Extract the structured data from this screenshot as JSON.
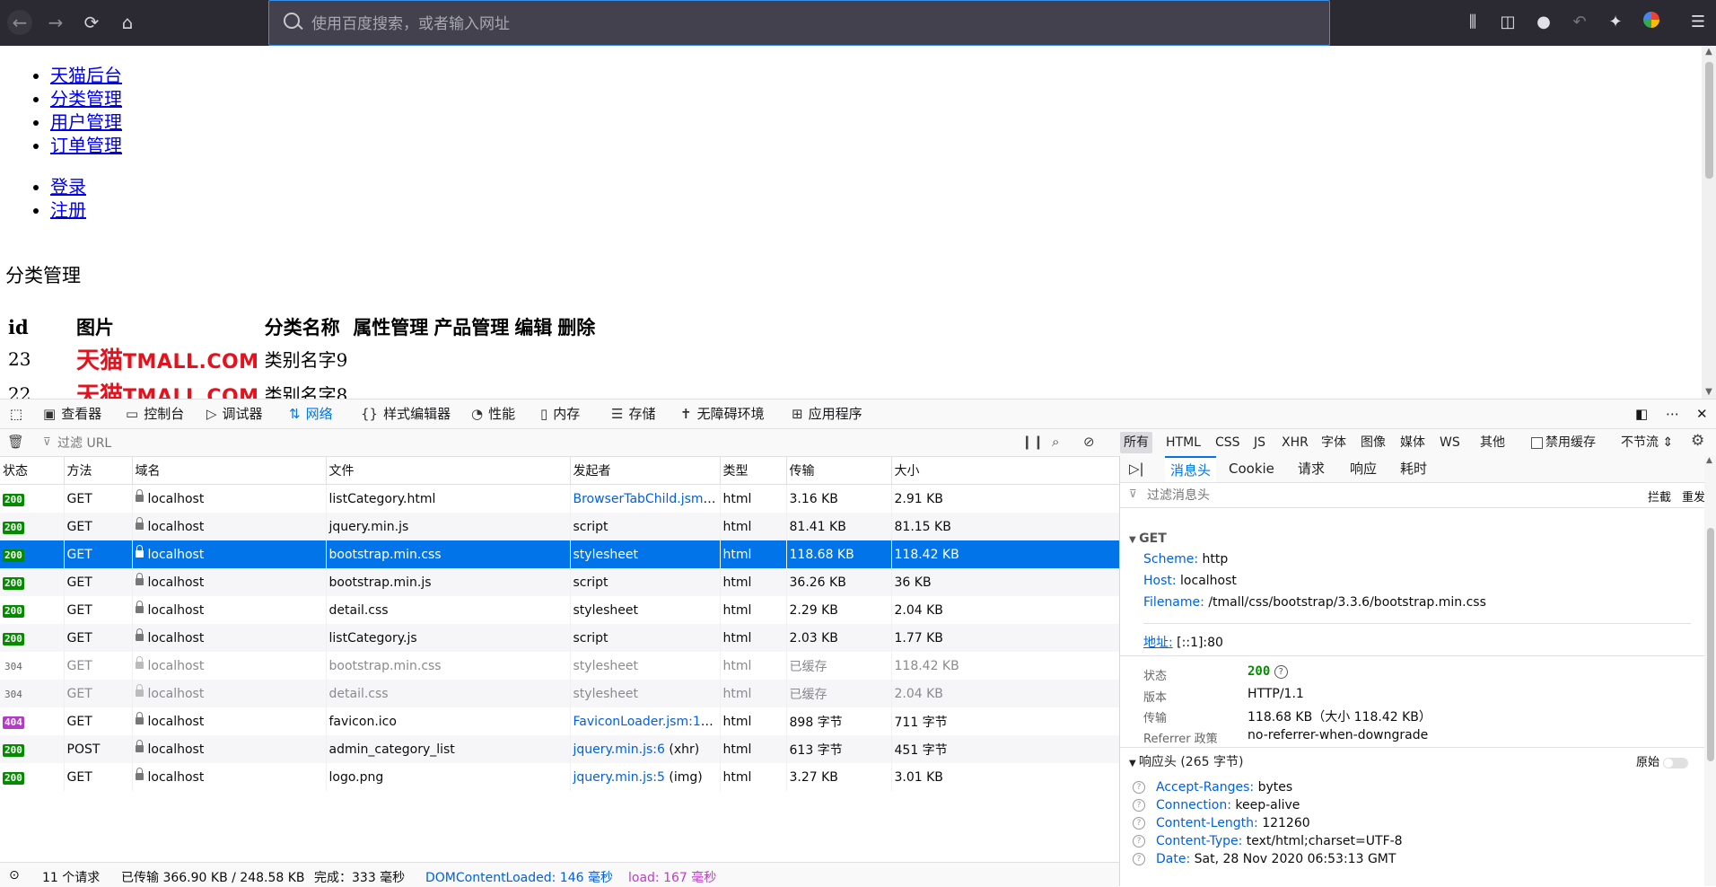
{
  "toolbar": {
    "back_icon": "back-arrow-icon",
    "forward_icon": "forward-arrow-icon",
    "reload_icon": "reload-icon",
    "home_icon": "home-icon",
    "url_placeholder": "使用百度搜索，或者输入网址",
    "right_icons": [
      "library-icon",
      "sidebar-icon",
      "account-icon",
      "undo-icon",
      "extension-icon",
      "browser-logo-icon",
      "menu-icon"
    ]
  },
  "page": {
    "nav_main": [
      "天猫后台",
      "分类管理",
      "用户管理",
      "订单管理"
    ],
    "nav_account": [
      "登录",
      "注册"
    ],
    "section_title": "分类管理",
    "table": {
      "headers": [
        "id",
        "图片",
        "分类名称",
        "属性管理",
        "产品管理",
        "编辑",
        "删除"
      ],
      "rows": [
        {
          "id": "23",
          "logo_cn": "天猫",
          "logo_en": "TMALL.COM",
          "name": "类别名字9"
        },
        {
          "id": "22",
          "logo_cn": "天猫",
          "logo_en": "TMALL.COM",
          "name": "类别名字8"
        }
      ]
    }
  },
  "devtools": {
    "tabs": [
      "查看器",
      "控制台",
      "调试器",
      "网络",
      "样式编辑器",
      "性能",
      "内存",
      "存储",
      "无障碍环境",
      "应用程序"
    ],
    "active_tab": "网络",
    "filter_placeholder": "过滤 URL",
    "type_filters": [
      "所有",
      "HTML",
      "CSS",
      "JS",
      "XHR",
      "字体",
      "图像",
      "媒体",
      "WS",
      "其他"
    ],
    "disable_cache": "禁用缓存",
    "throttle": "不节流",
    "columns": [
      "状态",
      "方法",
      "域名",
      "文件",
      "发起者",
      "类型",
      "传输",
      "大小"
    ],
    "requests": [
      {
        "status": "200",
        "method": "GET",
        "domain": "localhost",
        "file": "listCategory.html",
        "initiator": "BrowserTabChild.jsm:...",
        "type": "html",
        "transfer": "3.16 KB",
        "size": "2.91 KB"
      },
      {
        "status": "200",
        "method": "GET",
        "domain": "localhost",
        "file": "jquery.min.js",
        "initiator": "script",
        "type": "html",
        "transfer": "81.41 KB",
        "size": "81.15 KB"
      },
      {
        "status": "200",
        "method": "GET",
        "domain": "localhost",
        "file": "bootstrap.min.css",
        "initiator": "stylesheet",
        "type": "html",
        "transfer": "118.68 KB",
        "size": "118.42 KB"
      },
      {
        "status": "200",
        "method": "GET",
        "domain": "localhost",
        "file": "bootstrap.min.js",
        "initiator": "script",
        "type": "html",
        "transfer": "36.26 KB",
        "size": "36 KB"
      },
      {
        "status": "200",
        "method": "GET",
        "domain": "localhost",
        "file": "detail.css",
        "initiator": "stylesheet",
        "type": "html",
        "transfer": "2.29 KB",
        "size": "2.04 KB"
      },
      {
        "status": "200",
        "method": "GET",
        "domain": "localhost",
        "file": "listCategory.js",
        "initiator": "script",
        "type": "html",
        "transfer": "2.03 KB",
        "size": "1.77 KB"
      },
      {
        "status": "304",
        "method": "GET",
        "domain": "localhost",
        "file": "bootstrap.min.css",
        "initiator": "stylesheet",
        "type": "html",
        "transfer": "已缓存",
        "size": "118.42 KB"
      },
      {
        "status": "304",
        "method": "GET",
        "domain": "localhost",
        "file": "detail.css",
        "initiator": "stylesheet",
        "type": "html",
        "transfer": "已缓存",
        "size": "2.04 KB"
      },
      {
        "status": "404",
        "method": "GET",
        "domain": "localhost",
        "file": "favicon.ico",
        "initiator": "FaviconLoader.jsm:19...",
        "type": "html",
        "transfer": "898 字节",
        "size": "711 字节"
      },
      {
        "status": "200",
        "method": "POST",
        "domain": "localhost",
        "file": "admin_category_list",
        "initiator": "jquery.min.js:6",
        "initiator_suffix": " (xhr)",
        "type": "html",
        "transfer": "613 字节",
        "size": "451 字节"
      },
      {
        "status": "200",
        "method": "GET",
        "domain": "localhost",
        "file": "logo.png",
        "initiator": "jquery.min.js:5",
        "initiator_suffix": " (img)",
        "type": "html",
        "transfer": "3.27 KB",
        "size": "3.01 KB"
      }
    ],
    "statusbar": {
      "requests": "11 个请求",
      "transferred": "已传输 366.90 KB / 248.58 KB",
      "finish": "完成：333 毫秒",
      "dcl": "DOMContentLoaded: 146 毫秒",
      "load": "load: 167 毫秒"
    },
    "details": {
      "tabs": [
        "消息头",
        "Cookie",
        "请求",
        "响应",
        "耗时"
      ],
      "filter_placeholder": "过滤消息头",
      "block": "拦截",
      "resend": "重发",
      "method": "GET",
      "scheme_k": "Scheme:",
      "scheme_v": "http",
      "host_k": "Host:",
      "host_v": "localhost",
      "filename_k": "Filename:",
      "filename_v": "/tmall/css/bootstrap/3.3.6/bootstrap.min.css",
      "address_k": "地址:",
      "address_v": "[::1]:80",
      "status_k": "状态",
      "status_v": "200",
      "version_k": "版本",
      "version_v": "HTTP/1.1",
      "transfer_k": "传输",
      "transfer_v": "118.68 KB（大小 118.42 KB）",
      "referrer_k": "Referrer 政策",
      "referrer_v": "no-referrer-when-downgrade",
      "resp_headers": "响应头 (265 字节)",
      "raw": "原始",
      "headers": [
        {
          "k": "Accept-Ranges:",
          "v": "bytes"
        },
        {
          "k": "Connection:",
          "v": "keep-alive"
        },
        {
          "k": "Content-Length:",
          "v": "121260"
        },
        {
          "k": "Content-Type:",
          "v": "text/html;charset=UTF-8"
        },
        {
          "k": "Date:",
          "v": "Sat, 28 Nov 2020 06:53:13 GMT"
        }
      ]
    }
  }
}
